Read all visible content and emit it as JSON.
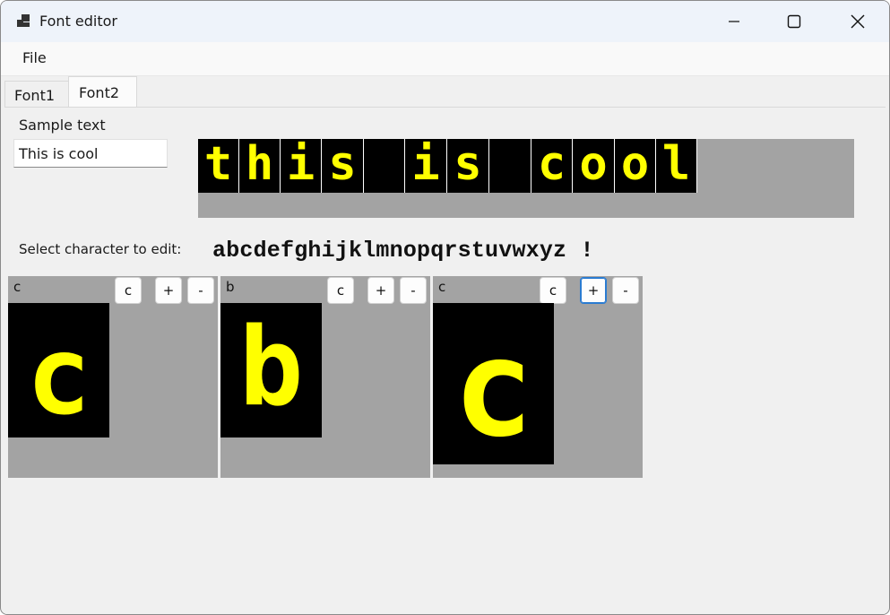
{
  "window": {
    "title": "Font editor",
    "icon": "app-window-icon"
  },
  "menu": {
    "file_label": "File"
  },
  "tabs": [
    {
      "label": "Font1"
    },
    {
      "label": "Font2",
      "selected": true
    }
  ],
  "sample": {
    "label": "Sample text",
    "value": "This is cool",
    "preview_chars": [
      "t",
      "h",
      "i",
      "s",
      " ",
      "i",
      "s",
      " ",
      "c",
      "o",
      "o",
      "l"
    ]
  },
  "charset": {
    "label": "Select character to edit:",
    "characters": "abcdefghijklmnopqrstuvwxyz !"
  },
  "editors": [
    {
      "char_label": "c",
      "glyph": "c",
      "buttons": [
        "c",
        "+",
        "-"
      ]
    },
    {
      "char_label": "b",
      "glyph": "b",
      "buttons": [
        "c",
        "+",
        "-"
      ]
    },
    {
      "char_label": "c",
      "glyph": "c",
      "buttons": [
        "c",
        "+",
        "-"
      ],
      "focused_button": "+"
    }
  ],
  "colors": {
    "glyph": "#ffff00",
    "background": "#000000",
    "panel": "#a3a3a3"
  }
}
